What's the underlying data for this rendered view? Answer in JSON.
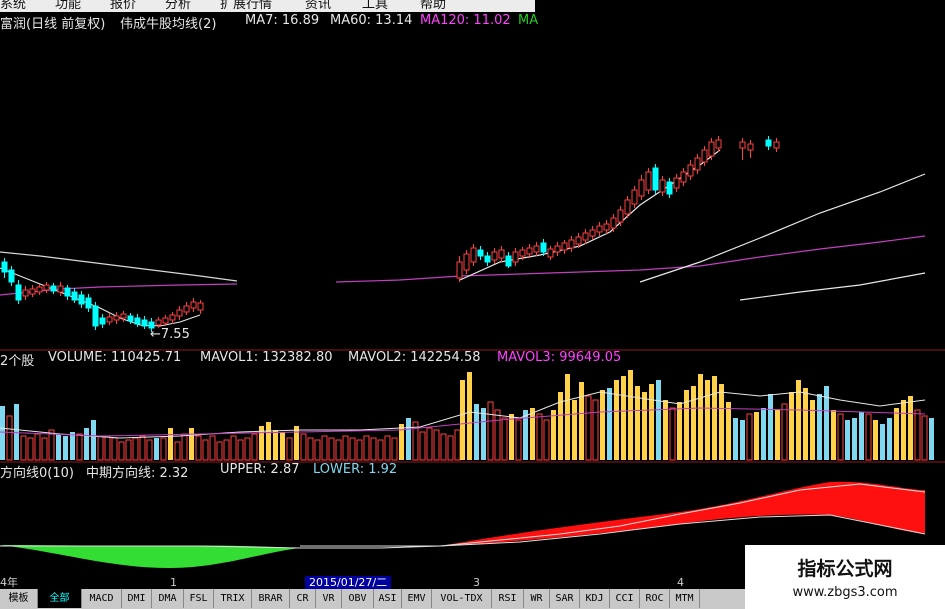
{
  "menu": {
    "items": [
      "系统",
      "功能",
      "报价",
      "分析",
      "扩展行情",
      "资讯",
      "工具",
      "帮助"
    ]
  },
  "header": {
    "stock": "富润(日线 前复权)",
    "indicator": "伟成牛股均线(2)",
    "ma7": "MA7: 16.89",
    "ma60": "MA60: 13.14",
    "ma120": "MA120: 11.02",
    "ma_extra": "MA"
  },
  "price_panel": {
    "low_label": "←7.55"
  },
  "volume_panel": {
    "prefix": "2个股",
    "volume": "VOLUME: 110425.71",
    "mavol1": "MAVOL1: 132382.80",
    "mavol2": "MAVOL2: 142254.58",
    "mavol3": "MAVOL3: 99649.05"
  },
  "direction_panel": {
    "prefix": "方向线0(10)",
    "mid": "中期方向线: 2.32",
    "upper": "UPPER: 2.87",
    "lower": "LOWER: 1.92"
  },
  "date_axis": {
    "left_label": "4年",
    "ticks": [
      "1",
      "3",
      "4"
    ],
    "current_date": "2015/01/27/二"
  },
  "tabs": [
    "模板",
    "全部",
    "MACD",
    "DMI",
    "DMA",
    "FSL",
    "TRIX",
    "BRAR",
    "CR",
    "VR",
    "OBV",
    "ASI",
    "EMV",
    "VOL-TDX",
    "RSI",
    "WR",
    "SAR",
    "KDJ",
    "CCI",
    "ROC",
    "MTM"
  ],
  "active_tab": "全部",
  "watermark": {
    "title": "指标公式网",
    "url": "www.zbgs3.com"
  },
  "colors": {
    "up": "#ff4040",
    "down": "#00ffff",
    "vol_up": "#ffd24a",
    "vol_down": "#7fd8f0",
    "ma_white": "#e8e8e8",
    "ma_purple": "#c040c0",
    "fill_red": "#ff1010",
    "fill_green": "#33dd33",
    "header_magenta": "#ff44ff",
    "header_green": "#22cc22"
  }
}
